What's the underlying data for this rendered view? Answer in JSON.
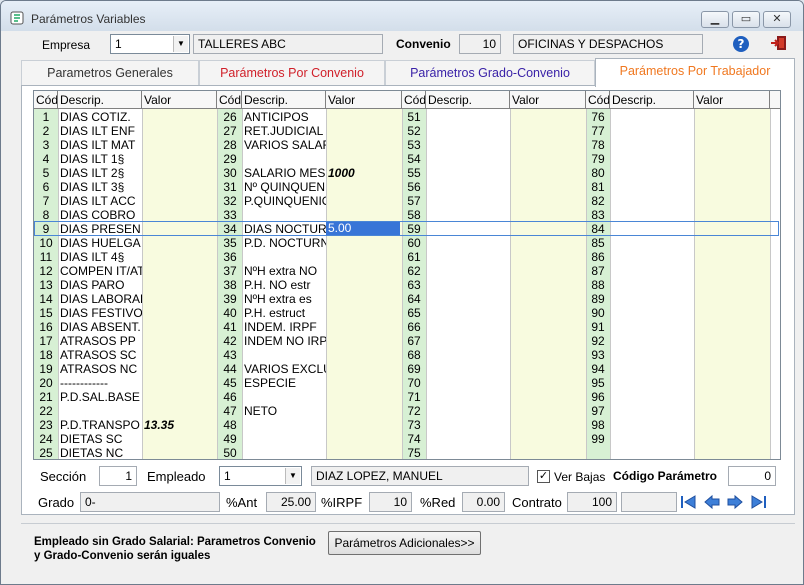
{
  "window": {
    "title": "Parámetros Variables"
  },
  "header": {
    "empresa_label": "Empresa",
    "empresa_value": "1",
    "empresa_name": "TALLERES ABC",
    "convenio_label": "Convenio",
    "convenio_value": "10",
    "convenio_name": "OFICINAS Y DESPACHOS"
  },
  "tabs": [
    {
      "label": "Parametros Generales",
      "color": "#333333"
    },
    {
      "label": "Parámetros Por Convenio",
      "color": "#d0202a"
    },
    {
      "label": "Parámetros Grado-Convenio",
      "color": "#3a22a8"
    },
    {
      "label": "Parámetros Por Trabajador",
      "color": "#f07820"
    }
  ],
  "grid": {
    "headers": [
      "Cód",
      "Descrip.",
      "Valor",
      "Cód",
      "Descrip.",
      "Valor",
      "Cód",
      "Descrip.",
      "Valor",
      "Cód",
      "Descrip.",
      "Valor"
    ],
    "col1": {
      "codes": [
        "1",
        "2",
        "3",
        "4",
        "5",
        "6",
        "7",
        "8",
        "9",
        "10",
        "11",
        "12",
        "13",
        "14",
        "15",
        "16",
        "17",
        "18",
        "19",
        "20",
        "21",
        "22",
        "23",
        "24",
        "25"
      ],
      "descs": [
        "DIAS COTIZ.",
        "DIAS ILT ENF",
        "DIAS ILT MAT",
        "DIAS ILT 1§",
        "DIAS ILT 2§",
        "DIAS ILT 3§",
        "DIAS ILT ACC",
        "DIAS COBRO",
        "DIAS PRESEN",
        "DIAS HUELGA",
        "DIAS ILT 4§",
        "COMPEN IT/AT",
        "DIAS PARO",
        "DIAS LABORAE",
        "DIAS FESTIVO",
        "DIAS ABSENT.",
        "ATRASOS PP",
        "ATRASOS SC",
        "ATRASOS NC",
        "------------",
        "P.D.SAL.BASE",
        "",
        "P.D.TRANSPO",
        "DIETAS SC",
        "DIETAS NC"
      ],
      "values": [
        "",
        "",
        "",
        "",
        "",
        "",
        "",
        "",
        "",
        "",
        "",
        "",
        "",
        "",
        "",
        "",
        "",
        "",
        "",
        "",
        "",
        "",
        "13.35",
        "",
        ""
      ]
    },
    "col2": {
      "codes": [
        "26",
        "27",
        "28",
        "29",
        "30",
        "31",
        "32",
        "33",
        "34",
        "35",
        "36",
        "37",
        "38",
        "39",
        "40",
        "41",
        "42",
        "43",
        "44",
        "45",
        "46",
        "47",
        "48",
        "49",
        "50"
      ],
      "descs": [
        "ANTICIPOS",
        "RET.JUDICIAL",
        "VARIOS SALAR",
        "",
        "SALARIO MES",
        "Nº QUINQUEN",
        "P.QUINQUENIO",
        "",
        "DIAS NOCTUR",
        "P.D. NOCTURN",
        "",
        "NºH extra NO",
        "P.H. NO estr",
        "NºH extra es",
        "P.H. estruct",
        "INDEM. IRPF",
        "INDEM NO IRP",
        "",
        "VARIOS EXCLU",
        "ESPECIE",
        "",
        "NETO",
        "",
        "",
        ""
      ],
      "values": [
        "",
        "",
        "",
        "",
        "1000",
        "",
        "",
        "",
        "5.00",
        "",
        "",
        "",
        "",
        "",
        "",
        "",
        "",
        "",
        "",
        "",
        "",
        "",
        "",
        "",
        ""
      ]
    },
    "col3": {
      "codes": [
        "51",
        "52",
        "53",
        "54",
        "55",
        "56",
        "57",
        "58",
        "59",
        "60",
        "61",
        "62",
        "63",
        "64",
        "65",
        "66",
        "67",
        "68",
        "69",
        "70",
        "71",
        "72",
        "73",
        "74",
        "75"
      ]
    },
    "col4": {
      "codes": [
        "76",
        "77",
        "78",
        "79",
        "80",
        "81",
        "82",
        "83",
        "84",
        "85",
        "86",
        "87",
        "88",
        "89",
        "90",
        "91",
        "92",
        "93",
        "94",
        "95",
        "96",
        "97",
        "98",
        "99",
        ""
      ]
    }
  },
  "bottom": {
    "seccion_label": "Sección",
    "seccion_value": "1",
    "empleado_label": "Empleado",
    "empleado_value": "1",
    "empleado_name": "DIAZ  LOPEZ, MANUEL",
    "ver_bajas_label": "Ver Bajas",
    "ver_bajas_checked": true,
    "codigo_label": "Código Parámetro",
    "codigo_value": "0",
    "grado_label": "Grado",
    "grado_value": "0-",
    "ant_label": "%Ant",
    "ant_value": "25.00",
    "irpf_label": "%IRPF",
    "irpf_value": "10",
    "red_label": "%Red",
    "red_value": "0.00",
    "contrato_label": "Contrato",
    "contrato_value": "100",
    "nav_icons": [
      "first-icon",
      "prev-icon",
      "next-icon",
      "last-icon"
    ]
  },
  "footer": {
    "info_line1": "Empleado sin Grado Salarial: Parametros Convenio",
    "info_line2": "y Grado-Convenio serán iguales",
    "button_label": "Parámetros Adicionales>>"
  },
  "colors": {
    "accent": "#3875d7",
    "code_col": "#d7f0d4",
    "value_col": "#f8fbdf"
  }
}
